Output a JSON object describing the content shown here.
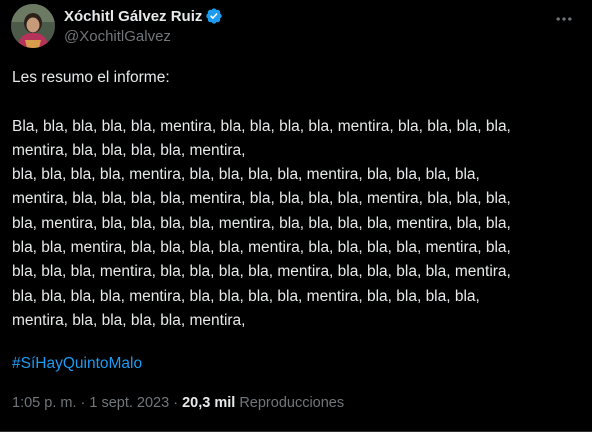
{
  "author": {
    "display_name": "Xóchitl Gálvez Ruiz",
    "handle": "@XochitlGalvez",
    "avatar_icon": "profile-photo",
    "verified_icon": "verified-badge-icon",
    "verified_color": "#1d9bf0"
  },
  "tweet": {
    "lines": [
      "Les resumo el informe:",
      "",
      "Bla, bla, bla, bla, bla, mentira, bla, bla, bla, bla, mentira, bla, bla, bla, bla,",
      "mentira, bla, bla, bla, bla, mentira,",
      "bla, bla, bla, bla, mentira, bla, bla, bla, bla, mentira, bla, bla, bla, bla,",
      "mentira, bla, bla, bla, bla, mentira, bla, bla, bla, bla, mentira, bla, bla, bla,",
      "bla, mentira, bla, bla, bla, bla, mentira, bla, bla, bla, bla, mentira, bla, bla,",
      "bla, bla, mentira, bla, bla, bla, bla, mentira, bla, bla, bla, bla, mentira, bla,",
      "bla, bla, bla, mentira, bla, bla, bla, bla, mentira, bla, bla, bla, bla, mentira,",
      "bla, bla, bla, bla, mentira, bla, bla, bla, bla, mentira, bla, bla, bla, bla,",
      "mentira, bla, bla, bla, bla, mentira,"
    ],
    "hashtag": "#SíHayQuintoMalo",
    "hashtag_color": "#1d9bf0"
  },
  "meta": {
    "time": "1:05 p. m.",
    "separator": " · ",
    "date": "1 sept. 2023",
    "views_count": "20,3 mil",
    "views_label": "Reproducciones"
  },
  "menu": {
    "more_icon": "more-options-icon"
  }
}
